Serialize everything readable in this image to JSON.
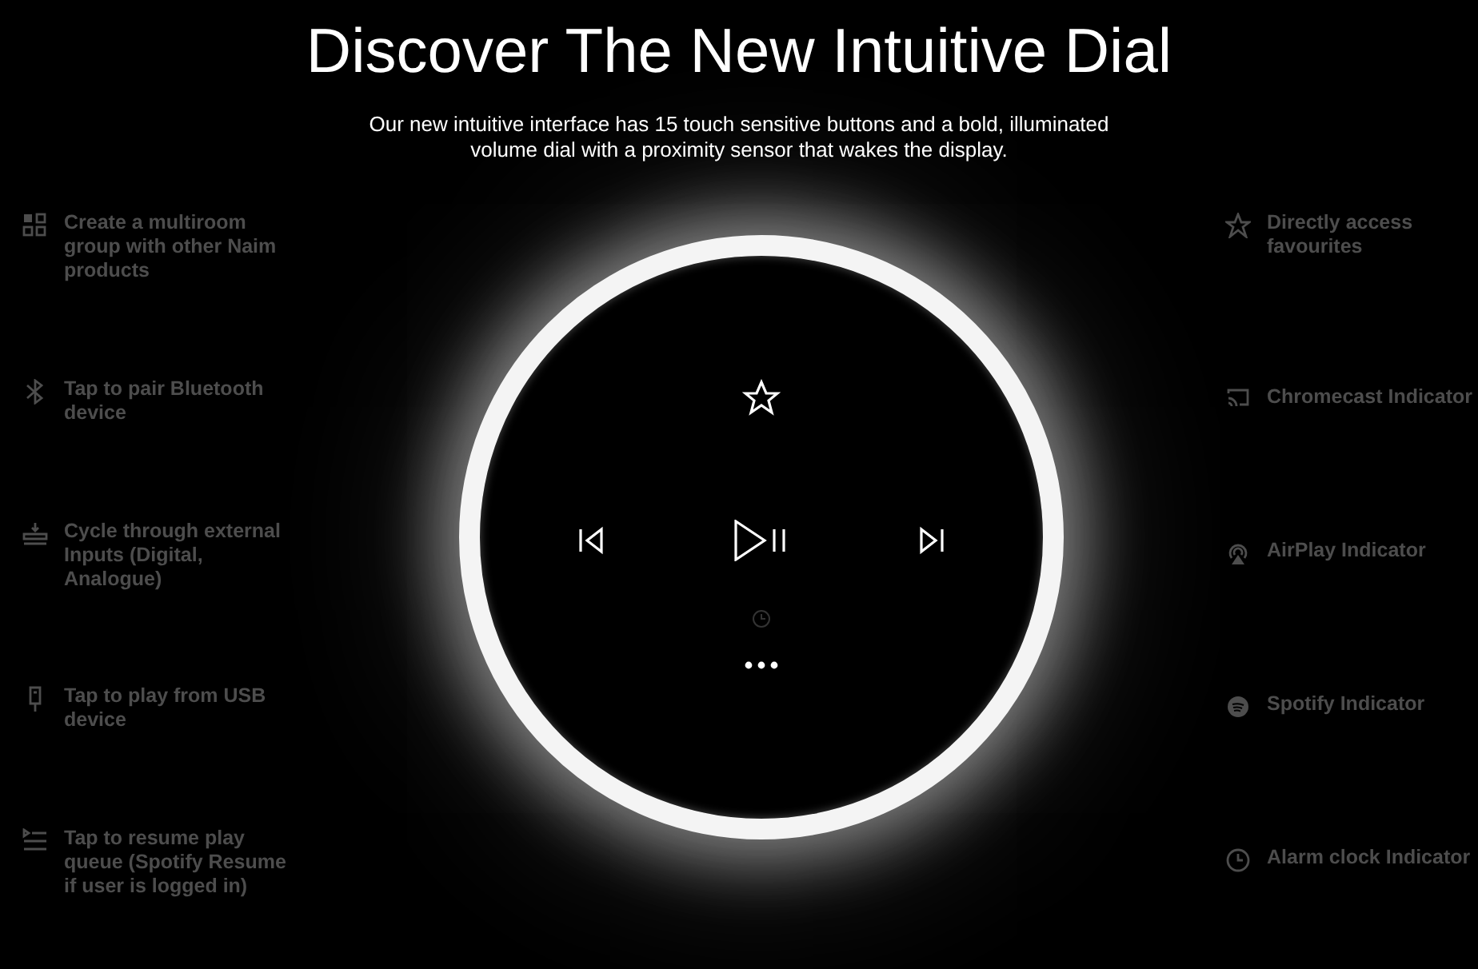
{
  "title": "Discover The New Intuitive Dial",
  "subtitle": "Our new intuitive interface has 15 touch sensitive buttons and a bold, illuminated volume dial with a proximity sensor that wakes the display.",
  "left_features": [
    {
      "text": "Create a multiroom group with other Naim products"
    },
    {
      "text": "Tap to pair Bluetooth device"
    },
    {
      "text": "Cycle through external Inputs (Digital, Analogue)"
    },
    {
      "text": "Tap to play from USB device"
    },
    {
      "text": "Tap to resume play queue (Spotify Resume if user is logged in)"
    }
  ],
  "right_features": [
    {
      "text": "Directly access favourites"
    },
    {
      "text": "Chromecast Indicator"
    },
    {
      "text": "AirPlay Indicator"
    },
    {
      "text": "Spotify Indicator"
    },
    {
      "text": "Alarm clock Indicator"
    }
  ]
}
